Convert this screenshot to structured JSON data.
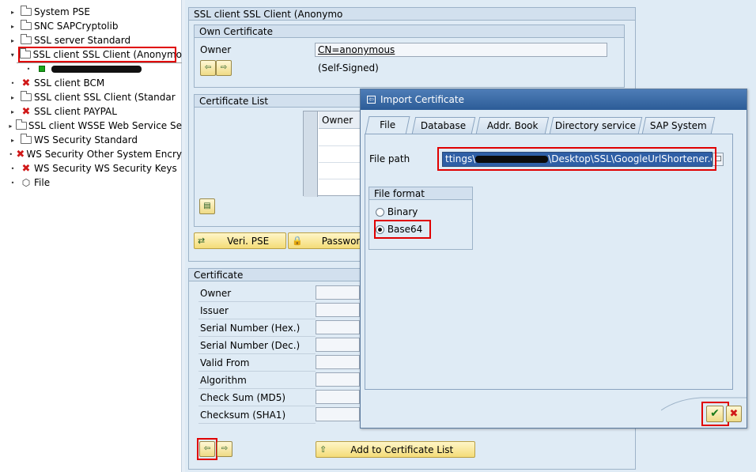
{
  "tree": {
    "items": [
      {
        "label": "System PSE",
        "icon": "folder-icon"
      },
      {
        "label": "SNC SAPCryptolib",
        "icon": "folder-icon"
      },
      {
        "label": "SSL server Standard",
        "icon": "folder-icon"
      },
      {
        "label": "SSL client SSL Client (Anonymo",
        "icon": "folder-open-icon"
      },
      {
        "label": "SSL client BCM",
        "icon": "error-x-icon"
      },
      {
        "label": "SSL client SSL Client (Standar",
        "icon": "folder-icon"
      },
      {
        "label": "SSL client PAYPAL",
        "icon": "error-x-icon"
      },
      {
        "label": "SSL client WSSE Web Service Se",
        "icon": "folder-icon"
      },
      {
        "label": "WS Security Standard",
        "icon": "folder-icon"
      },
      {
        "label": "WS Security Other System Encry",
        "icon": "error-x-icon"
      },
      {
        "label": "WS Security WS Security Keys",
        "icon": "error-x-icon"
      },
      {
        "label": "File",
        "icon": "cube-icon"
      }
    ]
  },
  "pse": {
    "title": "SSL client SSL Client (Anonymo",
    "own_cert": {
      "header": "Own Certificate",
      "owner_label": "Owner",
      "owner_value": "CN=anonymous",
      "self_signed": "(Self-Signed)"
    },
    "cert_list": {
      "header": "Certificate List",
      "column_owner": "Owner"
    },
    "buttons": {
      "verify": "Veri. PSE",
      "password": "Password"
    }
  },
  "certificate": {
    "header": "Certificate",
    "rows": [
      "Owner",
      "Issuer",
      "Serial Number (Hex.)",
      "Serial Number (Dec.)",
      "Valid From",
      "Algorithm",
      "Check Sum (MD5)",
      "Checksum (SHA1)"
    ],
    "add_button": "Add to Certificate List"
  },
  "dialog": {
    "title": "Import Certificate",
    "tabs": [
      "File",
      "Database",
      "Addr. Book",
      "Directory service",
      "SAP System"
    ],
    "active_tab": "File",
    "file_path_label": "File path",
    "file_path_prefix": "ttings\\",
    "file_path_suffix": "\\Desktop\\SSL\\GoogleUrlShortener.cer",
    "file_format": {
      "header": "File format",
      "options": [
        "Binary",
        "Base64"
      ],
      "selected": "Base64"
    }
  },
  "colors": {
    "highlight_red": "#e00000",
    "dialog_title_bg": "#2c5c97",
    "path_selection_bg": "#2f5fa6",
    "app_bg": "#dfebf5"
  }
}
